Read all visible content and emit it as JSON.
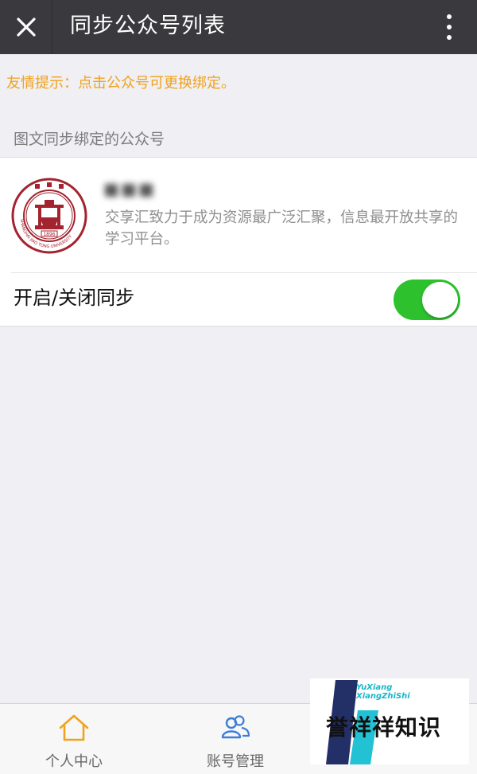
{
  "header": {
    "title": "同步公众号列表",
    "close_icon": "close-icon",
    "more_icon": "more-vertical-icon"
  },
  "tip": "友情提示：点击公众号可更换绑定。",
  "section_title": "图文同步绑定的公众号",
  "account": {
    "description": "交享汇致力于成为资源最广泛汇聚，信息最开放共享的学习平台。",
    "logo_icon": "sjtu-logo",
    "logo_text": "SHANGHAI JIAO TONG UNIVERSITY",
    "logo_year": "1896"
  },
  "sync": {
    "label": "开启/关闭同步",
    "enabled": true
  },
  "tabbar": {
    "home_label": "个人中心",
    "home_icon": "home-icon",
    "accounts_label": "账号管理",
    "accounts_icon": "users-icon"
  },
  "watermark": {
    "en_line1": "YuXiang",
    "en_line2": "XiangZhiShi",
    "cn": "誉祥祥知识"
  },
  "colors": {
    "header_bg": "#3a3a3e",
    "tip": "#f0a21c",
    "switch_on": "#2dc12e",
    "logo_red": "#a3232f",
    "tab_icon_home": "#f0a21c",
    "tab_icon_users": "#3b7dd8"
  }
}
